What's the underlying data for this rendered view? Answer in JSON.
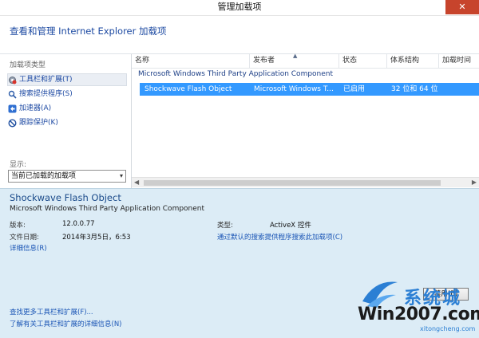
{
  "window": {
    "title": "管理加载项",
    "close_glyph": "✕"
  },
  "header": {
    "text": "查看和管理 Internet Explorer 加载项"
  },
  "sidebar": {
    "section_label": "加载项类型",
    "items": [
      {
        "label": "工具栏和扩展(T)",
        "icon": "gear-icon"
      },
      {
        "label": "搜索提供程序(S)",
        "icon": "search-icon"
      },
      {
        "label": "加速器(A)",
        "icon": "accelerator-icon"
      },
      {
        "label": "跟踪保护(K)",
        "icon": "tracking-protection-icon"
      }
    ],
    "show_label": "显示:",
    "show_select": {
      "value": "当前已加载的加载项",
      "arrow": "▾"
    }
  },
  "list": {
    "columns": [
      "名称",
      "发布者",
      "状态",
      "体系结构",
      "加载时间"
    ],
    "sort_glyph": "▲",
    "group": "Microsoft Windows Third Party Application Component",
    "rows": [
      {
        "name": "Shockwave Flash Object",
        "publisher": "Microsoft Windows T...",
        "status": "已启用",
        "arch": "32 位和 64 位"
      }
    ],
    "scroll": {
      "left": "◀",
      "right": "▶"
    }
  },
  "details": {
    "name": "Shockwave Flash Object",
    "publisher": "Microsoft Windows Third Party Application Component",
    "version_label": "版本:",
    "version_value": "12.0.0.77",
    "date_label": "文件日期:",
    "date_value": "2014年3月5日，6:53",
    "more_info_link": "详细信息(R)",
    "type_label": "类型:",
    "type_value": "ActiveX 控件",
    "search_link": "通过默认的搜索提供程序搜索此加载项(C)",
    "disable_button": "禁用(B)",
    "find_more_link": "查找更多工具栏和扩展(F)...",
    "learn_more_link": "了解有关工具栏和扩展的详细信息(N)"
  },
  "watermark": {
    "text": "Win2007.com",
    "cn": "系统城",
    "url": "xitongcheng.com"
  },
  "colors": {
    "accent": "#3399ff",
    "link": "#1a55b5",
    "details_bg": "#dcecf6",
    "close": "#c7442c"
  }
}
